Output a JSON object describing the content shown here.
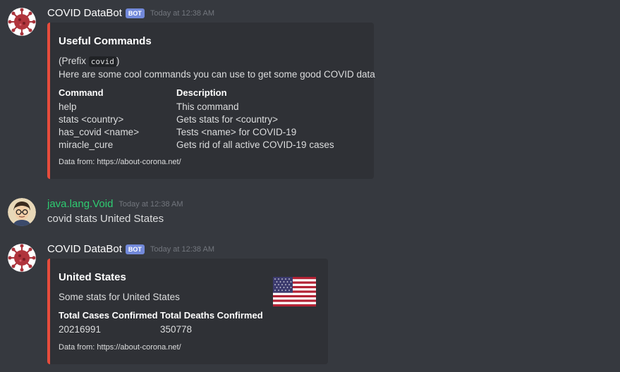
{
  "messages": [
    {
      "username": "COVID DataBot",
      "bot_tag": "BOT",
      "timestamp": "Today at 12:38 AM",
      "embed": {
        "title": "Useful Commands",
        "prefix_open": "(Prefix ",
        "prefix_code": "covid",
        "prefix_close": ")",
        "description": "Here are some cool commands you can use to get some good COVID data",
        "fields": [
          {
            "name": "Command",
            "values": [
              "help",
              "stats <country>",
              "has_covid <name>",
              "miracle_cure"
            ]
          },
          {
            "name": "Description",
            "values": [
              "This command",
              "Gets stats for <country>",
              "Tests <name> for COVID-19",
              "Gets rid of all active COVID-19 cases"
            ]
          }
        ],
        "footer": "Data from: https://about-corona.net/"
      }
    },
    {
      "username": "java.lang.Void",
      "timestamp": "Today at 12:38 AM",
      "content": "covid stats United States"
    },
    {
      "username": "COVID DataBot",
      "bot_tag": "BOT",
      "timestamp": "Today at 12:38 AM",
      "embed": {
        "title": "United States",
        "description": "Some stats for United States",
        "fields": [
          {
            "name": "Total Cases Confirmed",
            "value": "20216991"
          },
          {
            "name": "Total Deaths Confirmed",
            "value": "350778"
          }
        ],
        "footer": "Data from: https://about-corona.net/",
        "thumbnail": "us-flag"
      }
    }
  ],
  "colors": {
    "background": "#36393f",
    "embed_background": "#2f3136",
    "embed_accent": "#e74c3c",
    "bot_tag": "#7289da",
    "user_green": "#2ecc71",
    "timestamp": "#72767d"
  }
}
